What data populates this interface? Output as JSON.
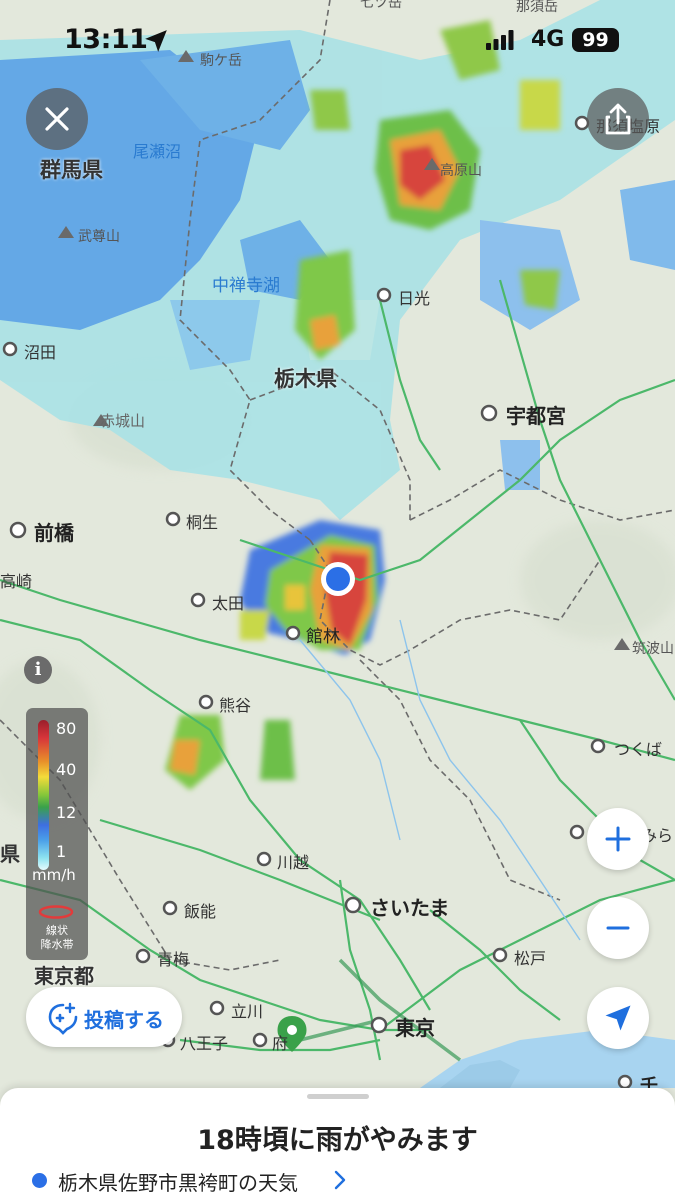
{
  "status_bar": {
    "time": "13:11",
    "network": "4G",
    "battery": "99",
    "icons": [
      "location-arrow-icon",
      "signal-bars-icon",
      "battery-icon"
    ]
  },
  "map": {
    "labels": {
      "gunma": "群馬県",
      "tochigi": "栃木県",
      "tokyo_to": "東京都",
      "oze": "尾瀬沼",
      "komagatake": "駒ケ岳",
      "buson": "武尊山",
      "chuzenji": "中禅寺湖",
      "akagi": "赤城山",
      "takahara": "高原山",
      "tsukuba_san": "筑波山",
      "nikko": "日光",
      "numata": "沼田",
      "utsunomiya": "宇都宮",
      "maebashi": "前橋",
      "kiryu": "桐生",
      "takasaki": "高崎",
      "ota": "太田",
      "tatebayashi": "館林",
      "kumagaya": "熊谷",
      "tsukuba": "つくば",
      "kawagoe": "川越",
      "saitama": "さいたま",
      "hanno": "飯能",
      "ome": "青梅",
      "matsudo": "松戸",
      "tachikawa": "立川",
      "hachioji": "八王子",
      "tokyo": "東京",
      "nasushiobara": "那須塩原",
      "fuchu_partial": "府",
      "chiba_partial": "千葉",
      "moriya_partial": "みら",
      "ken_partial": "県",
      "nasu_top": "那須岳",
      "top_partial": "七ツ岳"
    }
  },
  "buttons": {
    "close": "close-icon",
    "share": "share-icon",
    "info": "i",
    "post": "投稿する",
    "zoom_in": "plus-icon",
    "zoom_out": "minus-icon",
    "locate": "navigation-arrow-icon"
  },
  "legend": {
    "ticks": [
      "80",
      "40",
      "12",
      "1"
    ],
    "unit": "mm/h",
    "band_label_1": "線状",
    "band_label_2": "降水帯"
  },
  "sheet": {
    "headline": "18時頃に雨がやみます",
    "location": "栃木県佐野市黒袴町の天気"
  },
  "colors": {
    "accent": "#1f6fde",
    "location_dot": "#2b6fe6",
    "map_base": "#e3e8dc",
    "road": "#4cb86a"
  }
}
